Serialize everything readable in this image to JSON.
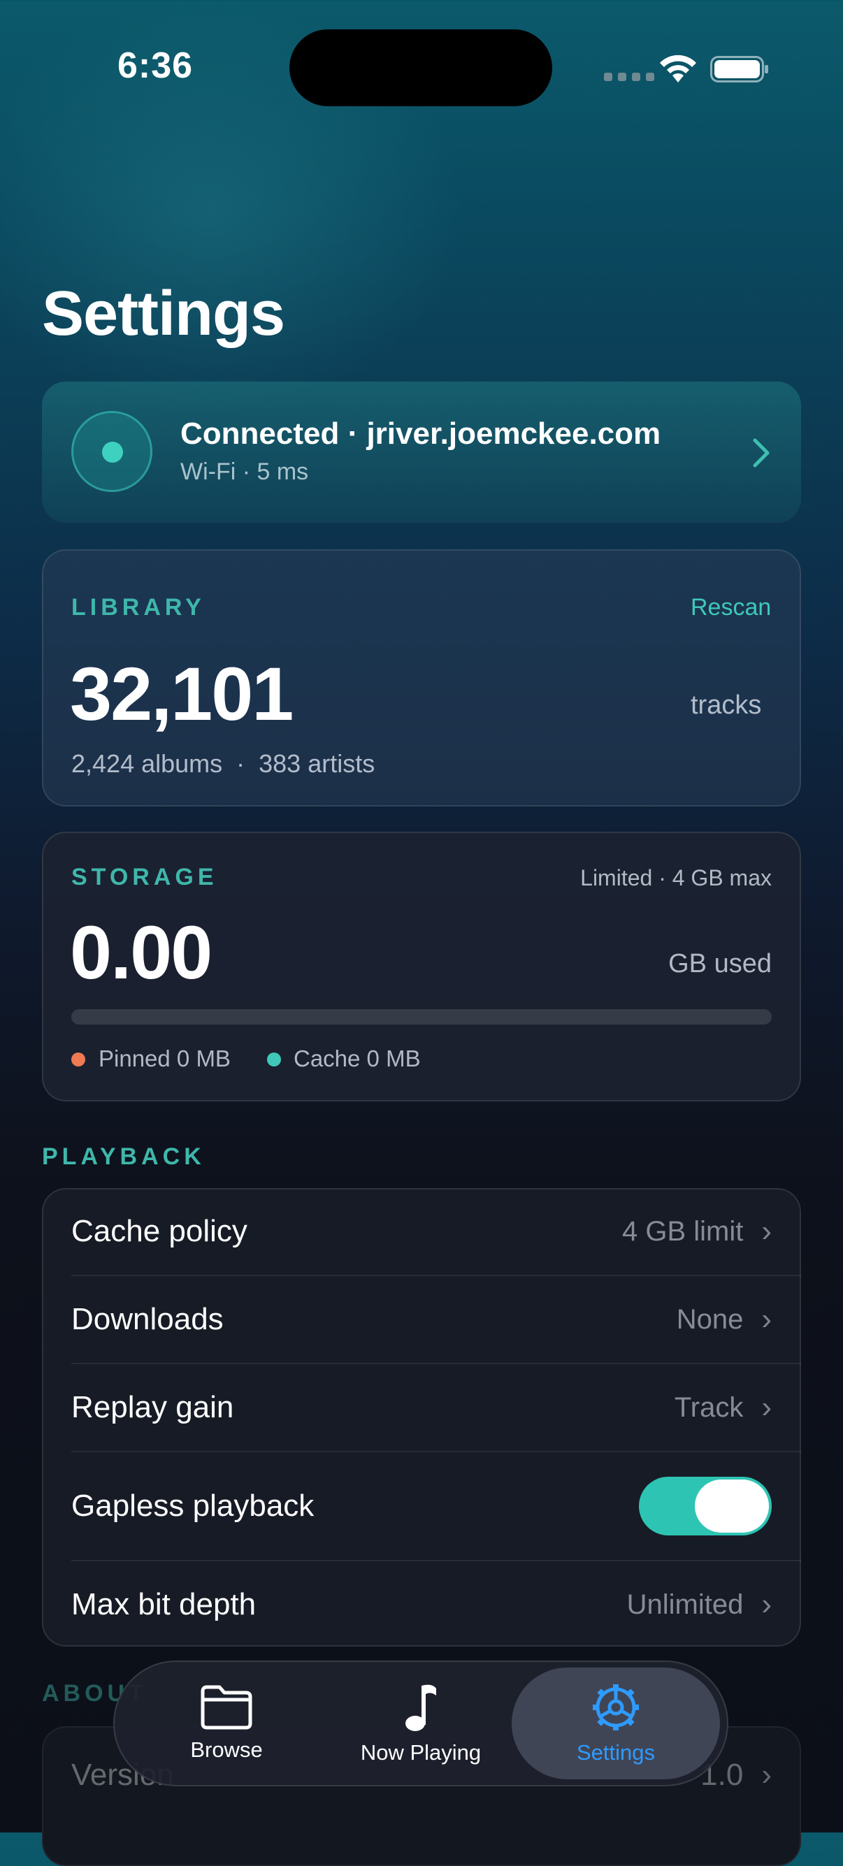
{
  "status": {
    "time": "6:36"
  },
  "page": {
    "title": "Settings"
  },
  "connection": {
    "title": "Connected · jriver.joemckee.com",
    "subtitle": "Wi-Fi · 5 ms"
  },
  "library": {
    "label": "LIBRARY",
    "action": "Rescan",
    "count": "32,101",
    "unit": "tracks",
    "detail": "2,424 albums  ·  383 artists"
  },
  "storage": {
    "label": "STORAGE",
    "limit": "Limited · 4 GB max",
    "used": "0.00",
    "unit": "GB used",
    "fill_fraction": 0,
    "legend": [
      {
        "label": "Pinned 0 MB",
        "color": "#f07a53"
      },
      {
        "label": "Cache 0 MB",
        "color": "#3fc8b8"
      }
    ]
  },
  "playback": {
    "label": "PLAYBACK",
    "rows": [
      {
        "label": "Cache policy",
        "value": "4 GB limit"
      },
      {
        "label": "Downloads",
        "value": "None"
      },
      {
        "label": "Replay gain",
        "value": "Track"
      },
      {
        "label": "Gapless playback",
        "toggle": true
      },
      {
        "label": "Max bit depth",
        "value": "Unlimited"
      }
    ]
  },
  "about": {
    "label": "ABOUT",
    "row_label": "Version",
    "row_value": "1.0"
  },
  "tabs": [
    {
      "label": "Browse",
      "icon": "folder-icon"
    },
    {
      "label": "Now Playing",
      "icon": "music-note-icon"
    },
    {
      "label": "Settings",
      "icon": "gear-icon",
      "active": true
    }
  ],
  "colors": {
    "accent": "#3fc8b8",
    "tab_active": "#2e9bff",
    "pinned": "#f07a53"
  }
}
